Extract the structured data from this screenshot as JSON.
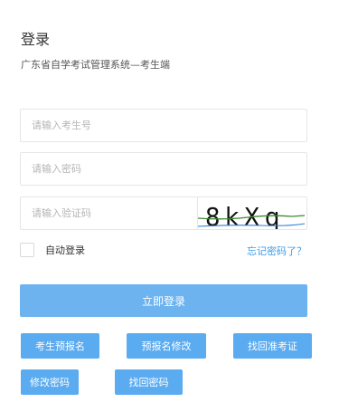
{
  "header": {
    "title": "登录",
    "subtitle": "广东省自学考试管理系统—考生端"
  },
  "form": {
    "id_placeholder": "请输入考生号",
    "password_placeholder": "请输入密码",
    "captcha_placeholder": "请输入验证码",
    "captcha_text": "8kXq",
    "remember_label": "自动登录",
    "remember_checked": false,
    "forgot_link": "忘记密码了？",
    "login_button": "立即登录"
  },
  "actions": {
    "pre_register": "考生预报名",
    "modify_pre_register": "预报名修改",
    "recover_ticket": "找回准考证",
    "change_password": "修改密码",
    "recover_password": "找回密码"
  },
  "colors": {
    "primary_button": "#6cb3f0",
    "secondary_button": "#5aabf0",
    "link": "#3a9ce8"
  }
}
